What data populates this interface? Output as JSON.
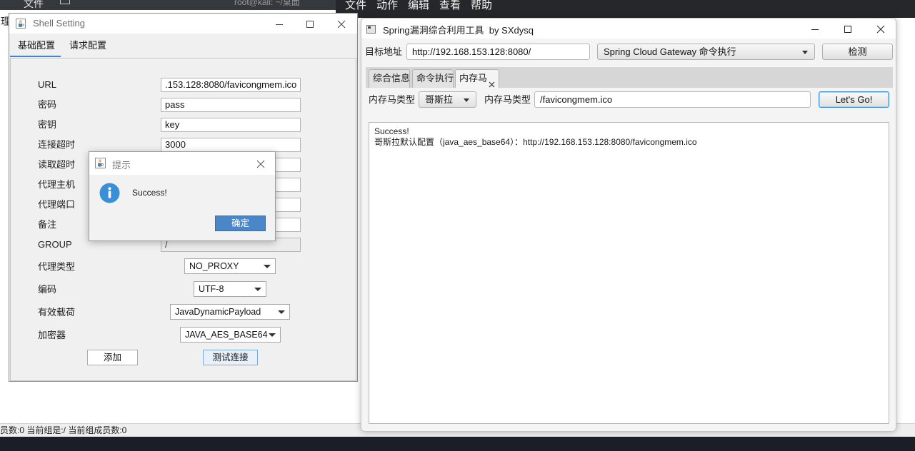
{
  "desktop": {
    "left_menu": "文件",
    "left_side_label": "管理",
    "terminal_title": "root@kali: ~/桌面",
    "terminal_menu": [
      "文件",
      "动作",
      "编辑",
      "查看",
      "帮助"
    ],
    "status_bar": "员数:0 当前组是:/ 当前组成员数:0"
  },
  "shell_setting": {
    "title": "Shell Setting",
    "icon": "java-icon",
    "tabs": [
      {
        "label": "基础配置",
        "selected": true
      },
      {
        "label": "请求配置",
        "selected": false
      }
    ],
    "fields": [
      {
        "label": "URL",
        "value": ".153.128:8080/favicongmem.ico"
      },
      {
        "label": "密码",
        "value": "pass"
      },
      {
        "label": "密钥",
        "value": "key"
      },
      {
        "label": "连接超时",
        "value": "3000"
      },
      {
        "label": "读取超时",
        "value": ""
      },
      {
        "label": "代理主机",
        "value": ""
      },
      {
        "label": "代理端口",
        "value": ""
      },
      {
        "label": "备注",
        "value": ""
      },
      {
        "label": "GROUP",
        "value": "/",
        "disabled": true
      }
    ],
    "selects": [
      {
        "label": "代理类型",
        "value": "NO_PROXY"
      },
      {
        "label": "编码",
        "value": "UTF-8"
      },
      {
        "label": "有效载荷",
        "value": "JavaDynamicPayload"
      },
      {
        "label": "加密器",
        "value": "JAVA_AES_BASE64"
      }
    ],
    "buttons": {
      "add": "添加",
      "test_connection": "测试连接"
    }
  },
  "alert_dialog": {
    "title": "提示",
    "icon": "info-icon",
    "message": "Success!",
    "ok_label": "确定"
  },
  "spring_tool": {
    "title": "Spring漏洞综合利用工具  by SXdysq",
    "target_label": "目标地址",
    "target_url": "http://192.168.153.128:8080/",
    "exploit_selected": "Spring Cloud Gateway 命令执行",
    "detect_label": "检测",
    "tabs": [
      {
        "label": "综合信息",
        "selected": false
      },
      {
        "label": "命令执行",
        "selected": false
      },
      {
        "label": "内存马",
        "selected": true,
        "closable": true
      }
    ],
    "memshell": {
      "type_label": "内存马类型",
      "type_value": "哥斯拉",
      "path_label": "内存马类型",
      "path_value": "/favicongmem.ico",
      "go_label": "Let's Go!"
    },
    "output_lines": [
      "Success!",
      "哥斯拉默认配置（java_aes_base64）：http://192.168.153.128:8080/favicongmem.ico"
    ]
  },
  "colors": {
    "accent_blue": "#4a86c8",
    "focus_blue": "#3c8fd9",
    "info_blue": "#3a8fd6",
    "tab_underline": "#3f83d8",
    "taskbar": "#1b1e26"
  }
}
